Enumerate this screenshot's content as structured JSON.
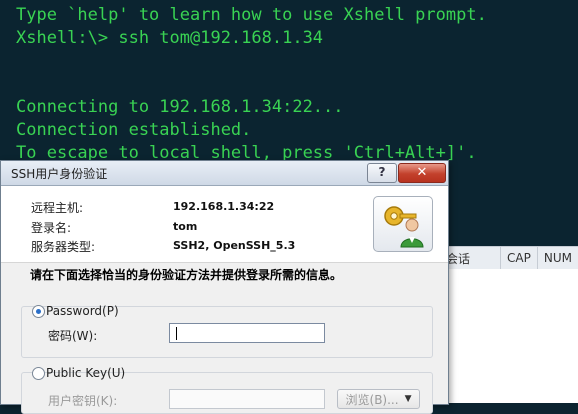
{
  "terminal": {
    "lines": [
      "Type `help' to learn how to use Xshell prompt.",
      "Xshell:\\> ssh tom@192.168.1.34",
      "",
      "",
      "Connecting to 192.168.1.34:22...",
      "Connection established.",
      "To escape to local shell, press 'Ctrl+Alt+]'."
    ],
    "text_color": "#39d353"
  },
  "background_status": {
    "left_fragment": "会话",
    "caps": "CAP",
    "num": "NUM"
  },
  "dialog": {
    "title": "SSH用户身份验证",
    "help_button": "?",
    "close_button": "✕",
    "info": {
      "remote_host_label": "远程主机:",
      "remote_host_value": "192.168.1.34:22",
      "login_name_label": "登录名:",
      "login_name_value": "tom",
      "server_type_label": "服务器类型:",
      "server_type_value": "SSH2, OpenSSH_5.3"
    },
    "instruction": "请在下面选择恰当的身份验证方法并提供登录所需的信息。",
    "password_option": {
      "label": "Password(P)",
      "selected": true,
      "field_label": "密码(W):",
      "value": ""
    },
    "public_key_option": {
      "label": "Public Key(U)",
      "selected": false,
      "field_label": "用户密钥(K):",
      "browse_label": "浏览(B)..."
    }
  },
  "colors": {
    "terminal_bg": "#0b2430",
    "terminal_text": "#39d353",
    "dialog_bg": "#f0f0f0",
    "close_red": "#c3412c",
    "radio_accent": "#2a6fc9"
  }
}
